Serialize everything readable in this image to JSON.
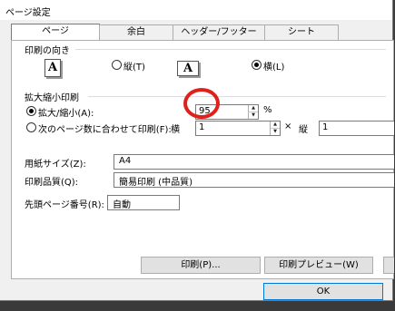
{
  "window": {
    "title": "ページ設定"
  },
  "tabs": [
    {
      "label": "ページ"
    },
    {
      "label": "余白"
    },
    {
      "label": "ヘッダー/フッター"
    },
    {
      "label": "シート"
    }
  ],
  "orientation": {
    "group_label": "印刷の向き",
    "portrait_label": "縦(T)",
    "landscape_label": "横(L)",
    "selected": "landscape",
    "icon_glyph": "A"
  },
  "scaling": {
    "group_label": "拡大縮小印刷",
    "zoom_label": "拡大/縮小(A):",
    "zoom_value": "95",
    "zoom_unit": "%",
    "fit_label": "次のページ数に合わせて印刷(F):",
    "wide_label": "横",
    "wide_value": "1",
    "times": "×",
    "tall_label": "縦",
    "tall_value": "1",
    "selected": "zoom"
  },
  "paper_size": {
    "label": "用紙サイズ(Z):",
    "value": "A4"
  },
  "print_quality": {
    "label": "印刷品質(Q):",
    "value": "簡易印刷 (中品質)"
  },
  "first_page": {
    "label": "先頭ページ番号(R):",
    "value": "自動"
  },
  "buttons": {
    "print": "印刷(P)...",
    "preview": "印刷プレビュー(W)",
    "ok": "OK"
  },
  "annotation_color": "#e0201b"
}
